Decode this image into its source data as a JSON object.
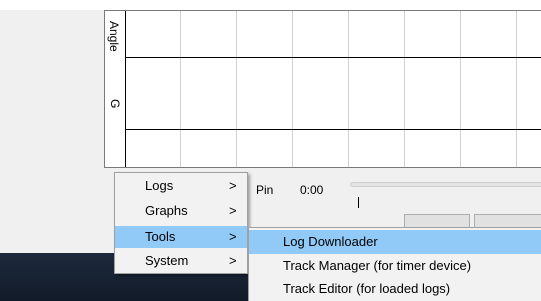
{
  "chart": {
    "y_label_top": "Angle",
    "y_label_bottom": "G"
  },
  "player": {
    "pin_label": "Pin",
    "time": "0:00"
  },
  "menu": {
    "items": [
      {
        "label": "Logs",
        "arrow": ">"
      },
      {
        "label": "Graphs",
        "arrow": ">"
      },
      {
        "label": "Tools",
        "arrow": ">"
      },
      {
        "label": "System",
        "arrow": ">"
      }
    ],
    "highlight_color": "#91c9f7"
  },
  "submenu": {
    "items": [
      {
        "label": "Log Downloader"
      },
      {
        "label": "Track Manager (for timer device)"
      },
      {
        "label": "Track Editor (for loaded logs)"
      }
    ]
  }
}
